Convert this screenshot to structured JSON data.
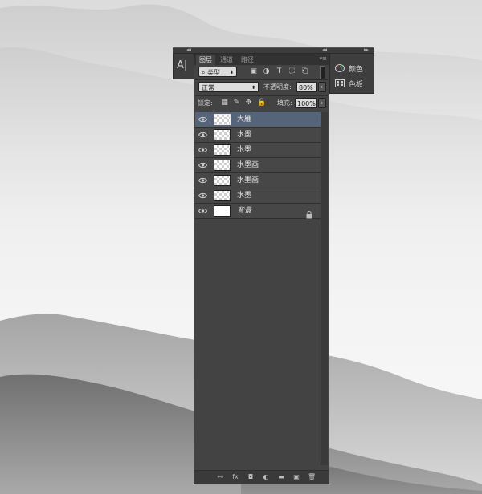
{
  "mini_panel": {
    "tool_icon": "character-tool-icon",
    "tool_glyph": "A|"
  },
  "side_panel": {
    "items": [
      {
        "icon": "color-palette-icon",
        "label": "颜色"
      },
      {
        "icon": "swatches-icon",
        "label": "色板"
      }
    ]
  },
  "layers_panel": {
    "tabs": [
      {
        "label": "图层",
        "active": true
      },
      {
        "label": "通道",
        "active": false
      },
      {
        "label": "路径",
        "active": false
      }
    ],
    "filter": {
      "search_glyph": "⌕",
      "kind": "类型"
    },
    "blend_mode": "正常",
    "opacity_label": "不透明度:",
    "opacity_value": "80%",
    "lock_label": "锁定:",
    "fill_label": "填充:",
    "fill_value": "100%",
    "layers": [
      {
        "name": "大雁",
        "selected": true,
        "thumb": "transparent",
        "visible": true
      },
      {
        "name": "水墨",
        "selected": false,
        "thumb": "transparent",
        "visible": true
      },
      {
        "name": "水墨",
        "selected": false,
        "thumb": "transparent",
        "visible": true
      },
      {
        "name": "水墨画",
        "selected": false,
        "thumb": "transparent",
        "visible": true
      },
      {
        "name": "水墨画",
        "selected": false,
        "thumb": "transparent",
        "visible": true
      },
      {
        "name": "水墨",
        "selected": false,
        "thumb": "transparent",
        "visible": true
      },
      {
        "name": "背景",
        "selected": false,
        "thumb": "white",
        "visible": true,
        "locked": true,
        "italic": true
      }
    ],
    "footer_icons": [
      "link-layers-icon",
      "fx-icon",
      "add-mask-icon",
      "adjustment-layer-icon",
      "new-group-icon",
      "new-layer-icon",
      "delete-layer-icon"
    ],
    "footer_glyphs": [
      "⚯",
      "fx",
      "◘",
      "◐",
      "▬",
      "▣",
      "🗑"
    ]
  },
  "colors": {
    "panel_bg": "#434343",
    "selected_row": "#56647a",
    "background_light": "#eaeaea",
    "mountain_dark": "#6e6e6e"
  }
}
